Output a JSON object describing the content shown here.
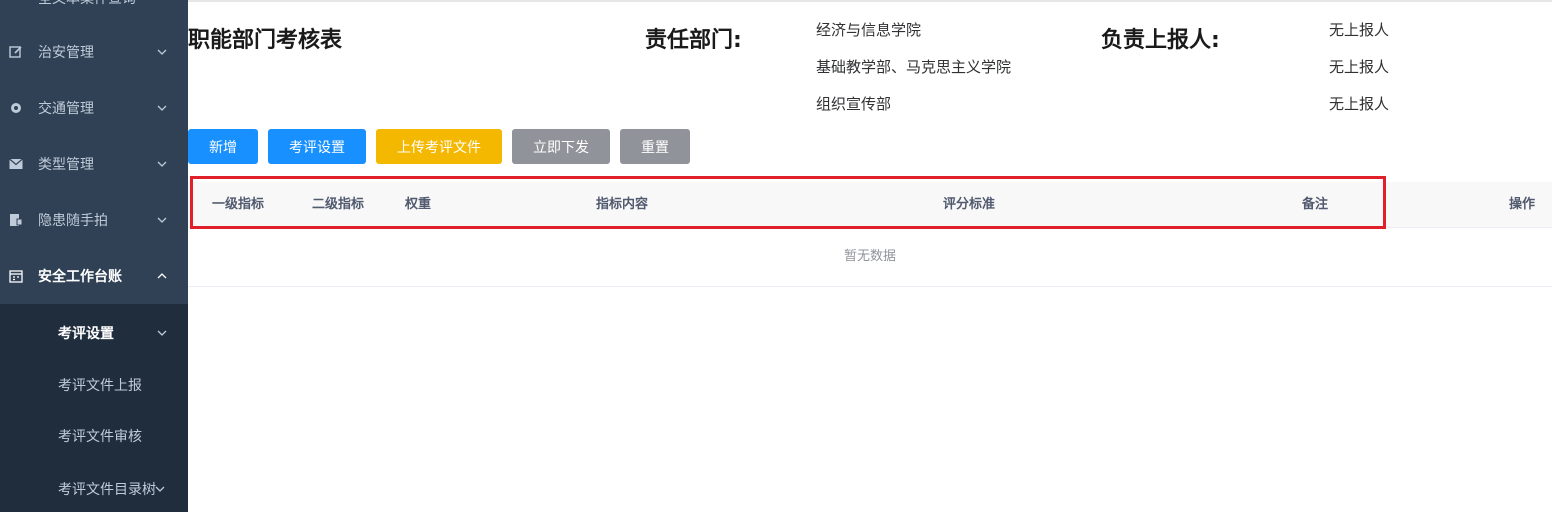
{
  "sidebar": {
    "partial_top_label": "全文本案件查询",
    "items": [
      {
        "label": "治安管理",
        "icon": "edit-icon"
      },
      {
        "label": "交通管理",
        "icon": "gear-icon"
      },
      {
        "label": "类型管理",
        "icon": "mail-icon"
      },
      {
        "label": "隐患随手拍",
        "icon": "camera-icon"
      },
      {
        "label": "安全工作台账",
        "icon": "calendar-icon"
      }
    ],
    "subitems": [
      {
        "label": "考评设置"
      },
      {
        "label": "考评文件上报"
      },
      {
        "label": "考评文件审核"
      },
      {
        "label": "考评文件目录树"
      }
    ]
  },
  "header": {
    "title": "职能部门考核表",
    "dept_label": "责任部门:",
    "reporter_label": "负责上报人:",
    "departments": [
      "经济与信息学院",
      "基础教学部、马克思主义学院",
      "组织宣传部"
    ],
    "reporters": [
      "无上报人",
      "无上报人",
      "无上报人"
    ]
  },
  "toolbar": {
    "add": "新增",
    "settings": "考评设置",
    "upload": "上传考评文件",
    "issue": "立即下发",
    "reset": "重置"
  },
  "table": {
    "columns": [
      "一级指标",
      "二级指标",
      "权重",
      "指标内容",
      "评分标准",
      "备注",
      "操作"
    ],
    "empty_text": "暂无数据"
  },
  "colors": {
    "sidebar_bg": "#304156",
    "submenu_bg": "#1f2d3d",
    "primary": "#1890ff",
    "warning": "#f5b800",
    "info": "#909399",
    "highlight": "#e0202a"
  }
}
